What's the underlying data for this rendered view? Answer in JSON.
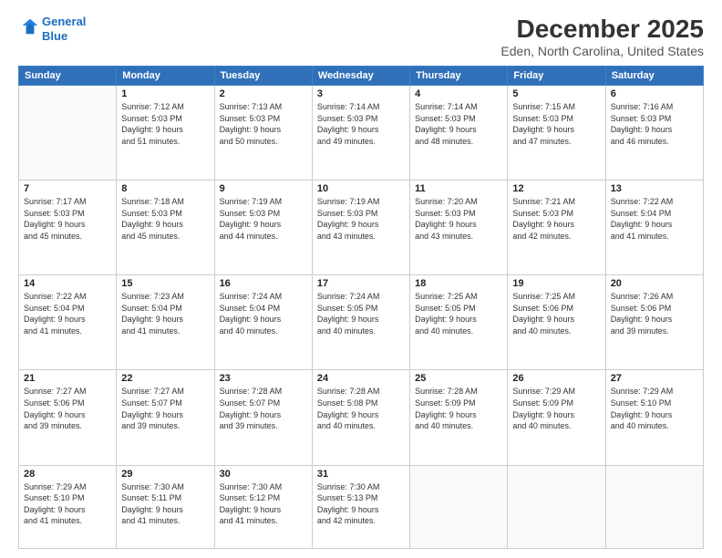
{
  "logo": {
    "line1": "General",
    "line2": "Blue"
  },
  "title": "December 2025",
  "subtitle": "Eden, North Carolina, United States",
  "days_header": [
    "Sunday",
    "Monday",
    "Tuesday",
    "Wednesday",
    "Thursday",
    "Friday",
    "Saturday"
  ],
  "weeks": [
    [
      {
        "day": "",
        "info": ""
      },
      {
        "day": "1",
        "info": "Sunrise: 7:12 AM\nSunset: 5:03 PM\nDaylight: 9 hours\nand 51 minutes."
      },
      {
        "day": "2",
        "info": "Sunrise: 7:13 AM\nSunset: 5:03 PM\nDaylight: 9 hours\nand 50 minutes."
      },
      {
        "day": "3",
        "info": "Sunrise: 7:14 AM\nSunset: 5:03 PM\nDaylight: 9 hours\nand 49 minutes."
      },
      {
        "day": "4",
        "info": "Sunrise: 7:14 AM\nSunset: 5:03 PM\nDaylight: 9 hours\nand 48 minutes."
      },
      {
        "day": "5",
        "info": "Sunrise: 7:15 AM\nSunset: 5:03 PM\nDaylight: 9 hours\nand 47 minutes."
      },
      {
        "day": "6",
        "info": "Sunrise: 7:16 AM\nSunset: 5:03 PM\nDaylight: 9 hours\nand 46 minutes."
      }
    ],
    [
      {
        "day": "7",
        "info": "Sunrise: 7:17 AM\nSunset: 5:03 PM\nDaylight: 9 hours\nand 45 minutes."
      },
      {
        "day": "8",
        "info": "Sunrise: 7:18 AM\nSunset: 5:03 PM\nDaylight: 9 hours\nand 45 minutes."
      },
      {
        "day": "9",
        "info": "Sunrise: 7:19 AM\nSunset: 5:03 PM\nDaylight: 9 hours\nand 44 minutes."
      },
      {
        "day": "10",
        "info": "Sunrise: 7:19 AM\nSunset: 5:03 PM\nDaylight: 9 hours\nand 43 minutes."
      },
      {
        "day": "11",
        "info": "Sunrise: 7:20 AM\nSunset: 5:03 PM\nDaylight: 9 hours\nand 43 minutes."
      },
      {
        "day": "12",
        "info": "Sunrise: 7:21 AM\nSunset: 5:03 PM\nDaylight: 9 hours\nand 42 minutes."
      },
      {
        "day": "13",
        "info": "Sunrise: 7:22 AM\nSunset: 5:04 PM\nDaylight: 9 hours\nand 41 minutes."
      }
    ],
    [
      {
        "day": "14",
        "info": "Sunrise: 7:22 AM\nSunset: 5:04 PM\nDaylight: 9 hours\nand 41 minutes."
      },
      {
        "day": "15",
        "info": "Sunrise: 7:23 AM\nSunset: 5:04 PM\nDaylight: 9 hours\nand 41 minutes."
      },
      {
        "day": "16",
        "info": "Sunrise: 7:24 AM\nSunset: 5:04 PM\nDaylight: 9 hours\nand 40 minutes."
      },
      {
        "day": "17",
        "info": "Sunrise: 7:24 AM\nSunset: 5:05 PM\nDaylight: 9 hours\nand 40 minutes."
      },
      {
        "day": "18",
        "info": "Sunrise: 7:25 AM\nSunset: 5:05 PM\nDaylight: 9 hours\nand 40 minutes."
      },
      {
        "day": "19",
        "info": "Sunrise: 7:25 AM\nSunset: 5:06 PM\nDaylight: 9 hours\nand 40 minutes."
      },
      {
        "day": "20",
        "info": "Sunrise: 7:26 AM\nSunset: 5:06 PM\nDaylight: 9 hours\nand 39 minutes."
      }
    ],
    [
      {
        "day": "21",
        "info": "Sunrise: 7:27 AM\nSunset: 5:06 PM\nDaylight: 9 hours\nand 39 minutes."
      },
      {
        "day": "22",
        "info": "Sunrise: 7:27 AM\nSunset: 5:07 PM\nDaylight: 9 hours\nand 39 minutes."
      },
      {
        "day": "23",
        "info": "Sunrise: 7:28 AM\nSunset: 5:07 PM\nDaylight: 9 hours\nand 39 minutes."
      },
      {
        "day": "24",
        "info": "Sunrise: 7:28 AM\nSunset: 5:08 PM\nDaylight: 9 hours\nand 40 minutes."
      },
      {
        "day": "25",
        "info": "Sunrise: 7:28 AM\nSunset: 5:09 PM\nDaylight: 9 hours\nand 40 minutes."
      },
      {
        "day": "26",
        "info": "Sunrise: 7:29 AM\nSunset: 5:09 PM\nDaylight: 9 hours\nand 40 minutes."
      },
      {
        "day": "27",
        "info": "Sunrise: 7:29 AM\nSunset: 5:10 PM\nDaylight: 9 hours\nand 40 minutes."
      }
    ],
    [
      {
        "day": "28",
        "info": "Sunrise: 7:29 AM\nSunset: 5:10 PM\nDaylight: 9 hours\nand 41 minutes."
      },
      {
        "day": "29",
        "info": "Sunrise: 7:30 AM\nSunset: 5:11 PM\nDaylight: 9 hours\nand 41 minutes."
      },
      {
        "day": "30",
        "info": "Sunrise: 7:30 AM\nSunset: 5:12 PM\nDaylight: 9 hours\nand 41 minutes."
      },
      {
        "day": "31",
        "info": "Sunrise: 7:30 AM\nSunset: 5:13 PM\nDaylight: 9 hours\nand 42 minutes."
      },
      {
        "day": "",
        "info": ""
      },
      {
        "day": "",
        "info": ""
      },
      {
        "day": "",
        "info": ""
      }
    ]
  ]
}
